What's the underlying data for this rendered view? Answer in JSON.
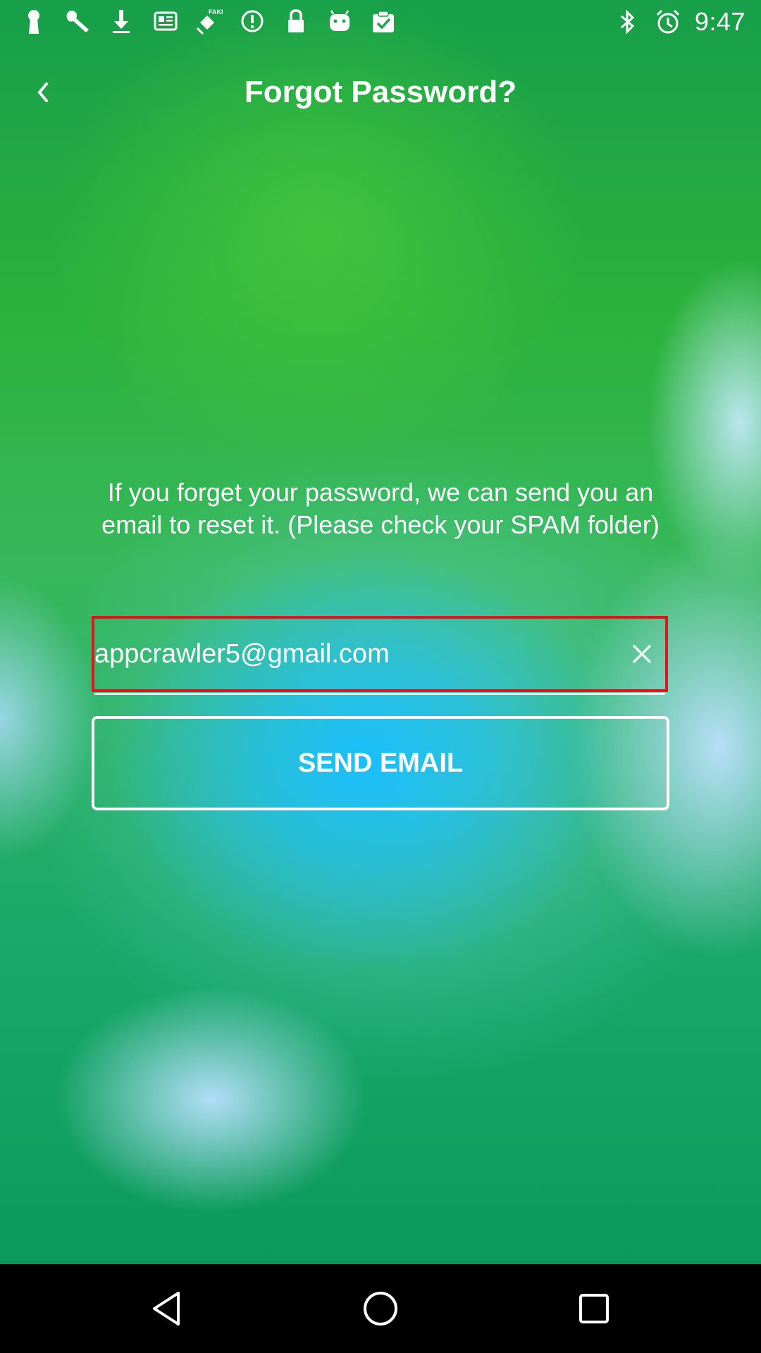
{
  "status_bar": {
    "left_icons": [
      "keyhole-icon",
      "wrench-icon",
      "download-icon",
      "news-icon",
      "fake-gps-icon",
      "alert-icon",
      "lock-icon",
      "android-icon",
      "clipboard-check-icon"
    ],
    "right_icons": [
      "bluetooth-icon",
      "alarm-icon"
    ],
    "time": "9:47"
  },
  "app_bar": {
    "back_icon": "chevron-left-icon",
    "title": "Forgot Password?"
  },
  "content": {
    "info_text": "If you forget your password, we can send you an email to reset it. (Please check your SPAM folder)",
    "email": {
      "value": "appcrawler5@gmail.com",
      "clear_icon": "close-icon",
      "highlight_color": "#e0161c"
    },
    "send_button_label": "SEND EMAIL"
  },
  "nav_bar": {
    "buttons": [
      "back-triangle-icon",
      "home-circle-icon",
      "recents-square-icon"
    ]
  }
}
